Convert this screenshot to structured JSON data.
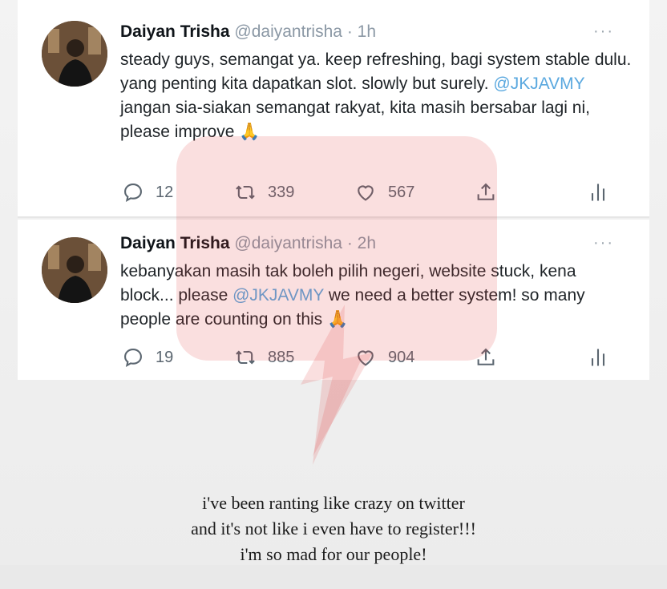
{
  "tweets": [
    {
      "name": "Daiyan Trisha",
      "handle": "@daiyantrisha",
      "dot": "·",
      "time": "1h",
      "more": "···",
      "text_1": "steady guys, semangat ya. keep refreshing, bagi system stable dulu. yang penting kita dapatkan slot. slowly but surely. ",
      "mention": "@JKJAVMY",
      "text_2": " jangan sia-siakan semangat rakyat, kita masih bersabar lagi ni, please improve ",
      "emoji": "🙏",
      "replies": "12",
      "retweets": "339",
      "likes": "567"
    },
    {
      "name": "Daiyan Trisha",
      "handle": "@daiyantrisha",
      "dot": "·",
      "time": "2h",
      "more": "···",
      "text_1": "kebanyakan masih tak boleh pilih negeri, website stuck, kena block... please ",
      "mention": "@JKJAVMY",
      "text_2": " we need a better system! so many people are counting on this ",
      "emoji": "🙏",
      "replies": "19",
      "retweets": "885",
      "likes": "904"
    }
  ],
  "icons": {
    "reply": "reply-icon",
    "retweet": "retweet-icon",
    "like": "heart-icon",
    "share": "share-icon",
    "stats": "analytics-icon",
    "more": "more-icon"
  },
  "caption": {
    "line1": "i've been ranting like crazy on twitter",
    "line2": "and it's not like i even have to register!!!",
    "line3": "i'm so mad for our people!"
  },
  "colors": {
    "mention": "#5aa8df",
    "watermark": "#e23a3a"
  }
}
